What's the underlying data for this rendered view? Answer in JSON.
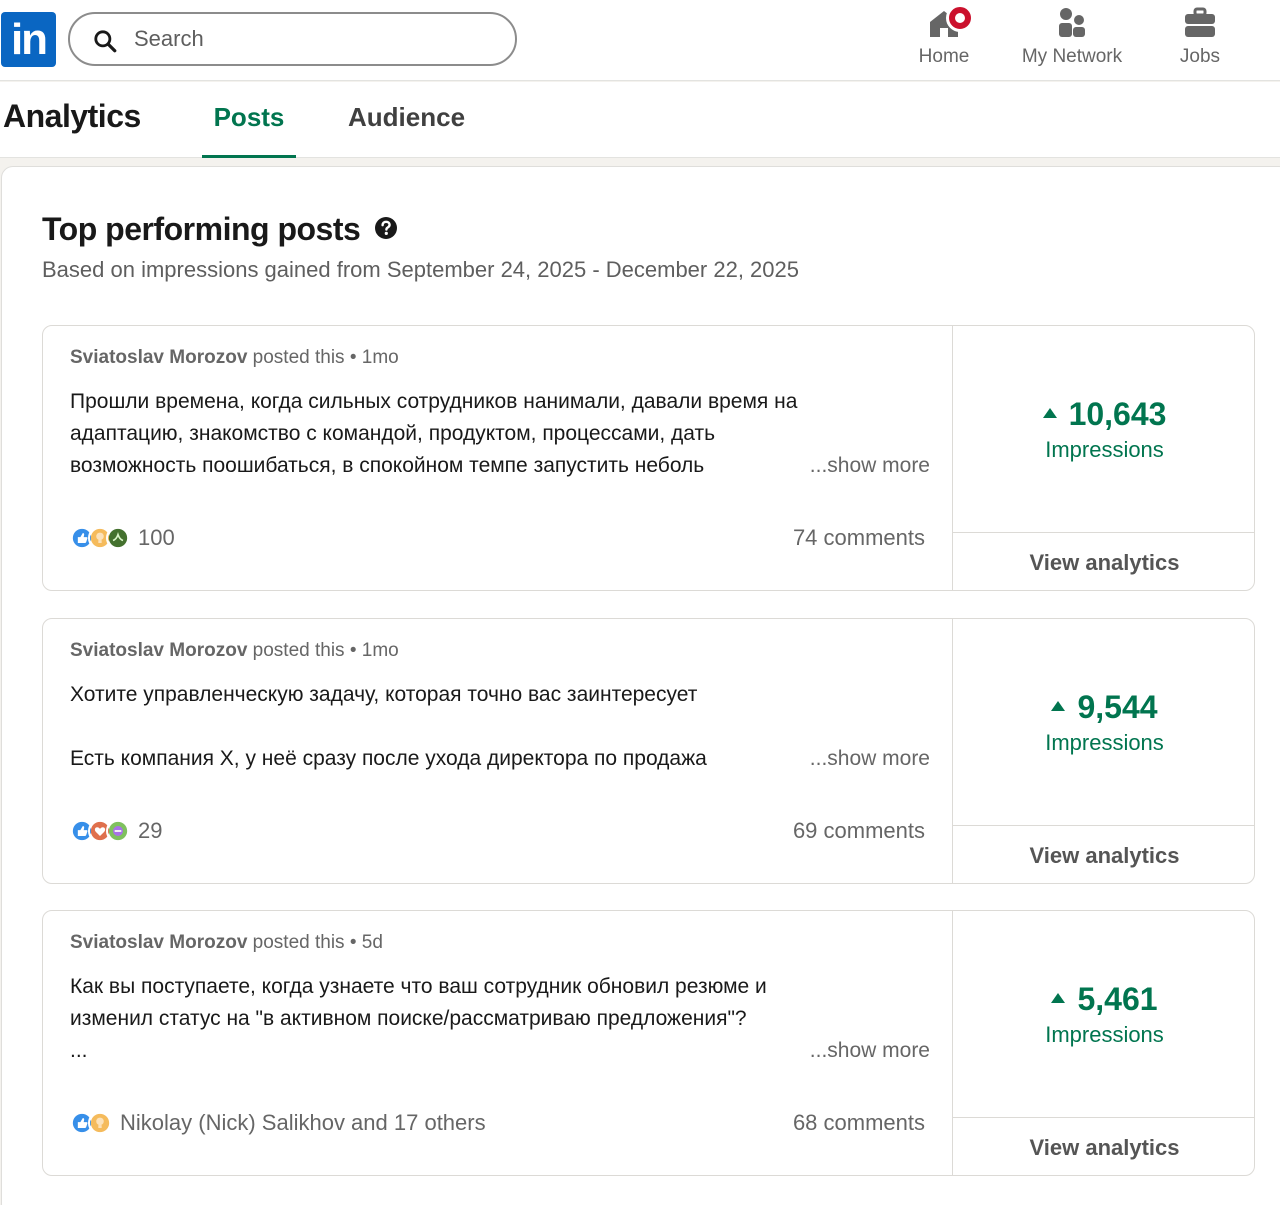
{
  "nav": {
    "logo_text": "in",
    "search_placeholder": "Search",
    "items": [
      {
        "label": "Home",
        "icon": "home-icon"
      },
      {
        "label": "My Network",
        "icon": "people-icon"
      },
      {
        "label": "Jobs",
        "icon": "briefcase-icon"
      }
    ]
  },
  "header": {
    "title": "Analytics",
    "tabs": [
      {
        "label": "Posts",
        "active": true
      },
      {
        "label": "Audience",
        "active": false
      }
    ]
  },
  "section": {
    "title": "Top performing posts",
    "subtitle": "Based on impressions gained from September 24, 2025 - December 22, 2025"
  },
  "posts": [
    {
      "author": "Sviatoslav Morozov",
      "meta_suffix": " posted this • 1mo",
      "lines": [
        "Прошли времена, когда сильных сотрудников нанимали, давали время на",
        "адаптацию, знакомство с командой, продуктом, процессами, дать",
        "возможность поошибаться, в спокойном темпе запустить неболь"
      ],
      "show_more": "...show more",
      "reactions": "100",
      "comments": "74 comments",
      "impressions": "10,643",
      "impressions_label": "Impressions",
      "view_analytics": "View analytics"
    },
    {
      "author": "Sviatoslav Morozov",
      "meta_suffix": " posted this • 1mo",
      "lines": [
        "Хотите управленческую задачу, которая точно вас заинтересует",
        "",
        "Есть компания X, у неё сразу после ухода директора по продажа"
      ],
      "show_more": "...show more",
      "reactions": "29",
      "comments": "69 comments",
      "impressions": "9,544",
      "impressions_label": "Impressions",
      "view_analytics": "View analytics"
    },
    {
      "author": "Sviatoslav Morozov",
      "meta_suffix": " posted this • 5d",
      "lines": [
        "Как вы поступаете, когда узнаете что ваш сотрудник обновил резюме и",
        "изменил статус на \"в активном поиске/рассматриваю предложения\"?",
        "..."
      ],
      "show_more": "...show more",
      "reactions": "Nikolay (Nick) Salikhov and 17 others",
      "comments": "68 comments",
      "impressions": "5,461",
      "impressions_label": "Impressions",
      "view_analytics": "View analytics"
    }
  ],
  "colors": {
    "brand": "#0a66c2",
    "accent_green": "#01754f",
    "notification_red": "#cb112d"
  }
}
